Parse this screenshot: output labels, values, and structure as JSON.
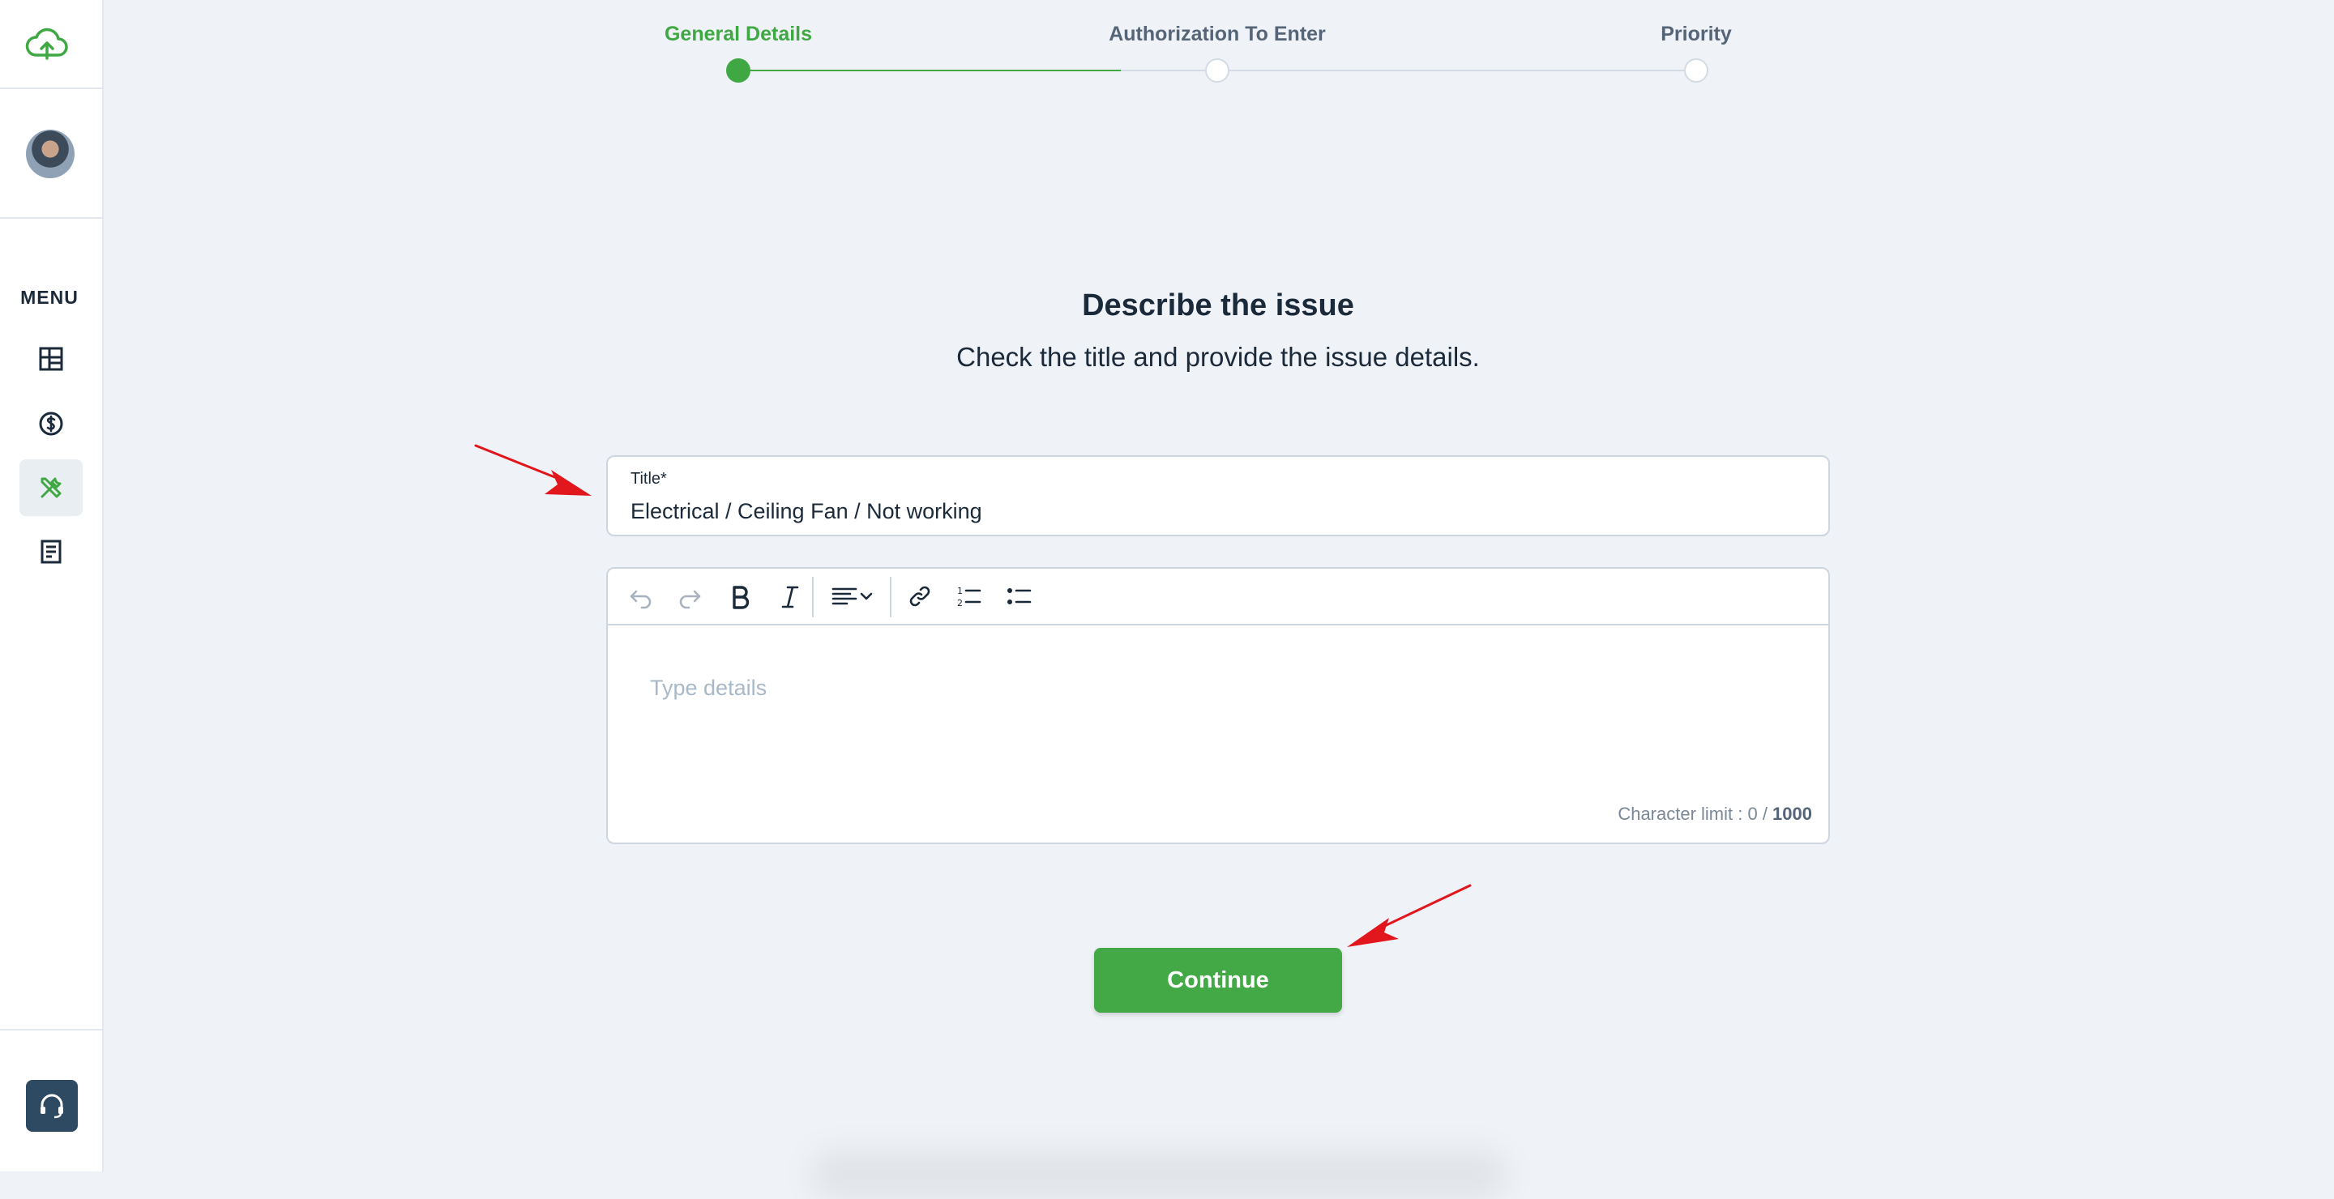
{
  "sidebar": {
    "menu_label": "MENU",
    "items": [
      {
        "icon": "dashboard-icon"
      },
      {
        "icon": "dollar-icon"
      },
      {
        "icon": "tools-icon",
        "active": true
      },
      {
        "icon": "document-icon"
      }
    ],
    "support_icon": "headset-icon"
  },
  "stepper": {
    "steps": [
      {
        "label": "General Details",
        "state": "active"
      },
      {
        "label": "Authorization To Enter",
        "state": "inactive"
      },
      {
        "label": "Priority",
        "state": "inactive"
      }
    ]
  },
  "main": {
    "heading": "Describe the issue",
    "subheading": "Check the title and provide the issue details."
  },
  "title_field": {
    "label": "Title*",
    "value": "Electrical / Ceiling Fan / Not working"
  },
  "editor": {
    "placeholder": "Type details",
    "char_limit_prefix": "Character limit : 0 / ",
    "char_limit_max": "1000"
  },
  "actions": {
    "continue_label": "Continue"
  },
  "colors": {
    "accent": "#43a846",
    "annotation": "#e2161d",
    "background": "#eff2f7"
  }
}
